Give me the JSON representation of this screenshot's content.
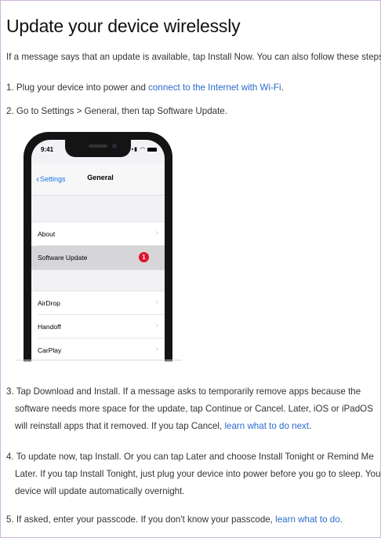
{
  "article": {
    "title": "Update your device wirelessly",
    "intro": "If a message says that an update is available, tap Install Now. You can also follow these steps:",
    "steps": {
      "s1_num": "1.",
      "s1_text": "Plug your device into power and ",
      "s1_link": "connect to the Internet with Wi-Fi",
      "s1_end": ".",
      "s2_num": "2.",
      "s2_text": "Go to Settings > General, then tap Software Update.",
      "s3_num": "3.",
      "s3_text": "Tap Download and Install. If a message asks to temporarily remove apps because the software needs more space for the update, tap Continue or Cancel. Later, iOS or iPadOS will reinstall apps that it removed. If you tap Cancel, ",
      "s3_link": "learn what to do next",
      "s3_end": ".",
      "s4_num": "4.",
      "s4_text": "To update now, tap Install. Or you can tap Later and choose Install Tonight or Remind Me Later. If you tap Install Tonight, just plug your device into power before you go to sleep. Your device will update automatically overnight.",
      "s5_num": "5.",
      "s5_text": "If asked, enter your passcode. If you don't know your passcode, ",
      "s5_link": "learn what to do",
      "s5_end": "."
    }
  },
  "phone": {
    "time": "9:41",
    "back_label": "Settings",
    "nav_title": "General",
    "rows_group1": [
      {
        "label": "About"
      },
      {
        "label": "Software Update",
        "badge": "1"
      }
    ],
    "rows_group2": [
      {
        "label": "AirDrop"
      },
      {
        "label": "Handoff"
      },
      {
        "label": "CarPlay"
      }
    ]
  },
  "colors": {
    "link": "#2a6acd",
    "badge": "#e4112a",
    "frame_border": "#cdb6e0"
  }
}
